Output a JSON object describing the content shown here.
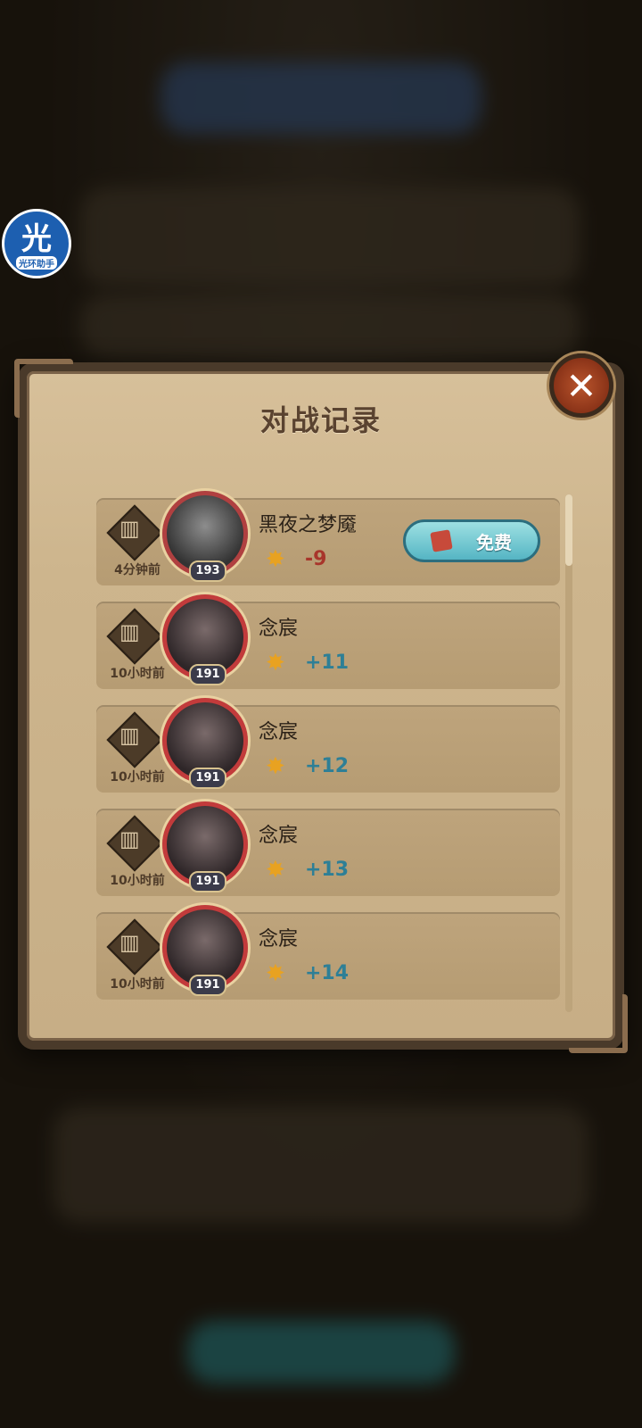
{
  "panel": {
    "title": "对战记录",
    "close_icon": "close-icon"
  },
  "helper": {
    "glyph": "光",
    "label": "光环助手"
  },
  "records": [
    {
      "time": "4分钟前",
      "name": "黑夜之梦魇",
      "level": "193",
      "score": "-9",
      "action": "免费",
      "avatar_style": "dark",
      "score_type": "neg"
    },
    {
      "time": "10小时前",
      "name": "念宸",
      "level": "191",
      "score": "+11",
      "avatar_style": "red",
      "score_type": "pos"
    },
    {
      "time": "10小时前",
      "name": "念宸",
      "level": "191",
      "score": "+12",
      "avatar_style": "red",
      "score_type": "pos"
    },
    {
      "time": "10小时前",
      "name": "念宸",
      "level": "191",
      "score": "+13",
      "avatar_style": "red",
      "score_type": "pos"
    },
    {
      "time": "10小时前",
      "name": "念宸",
      "level": "191",
      "score": "+14",
      "avatar_style": "red",
      "score_type": "pos"
    }
  ],
  "colors": {
    "panel_bg": "#d7c09a",
    "score_negative": "#a8352b",
    "score_positive": "#2e7f96",
    "free_button": "#55b5c4"
  }
}
